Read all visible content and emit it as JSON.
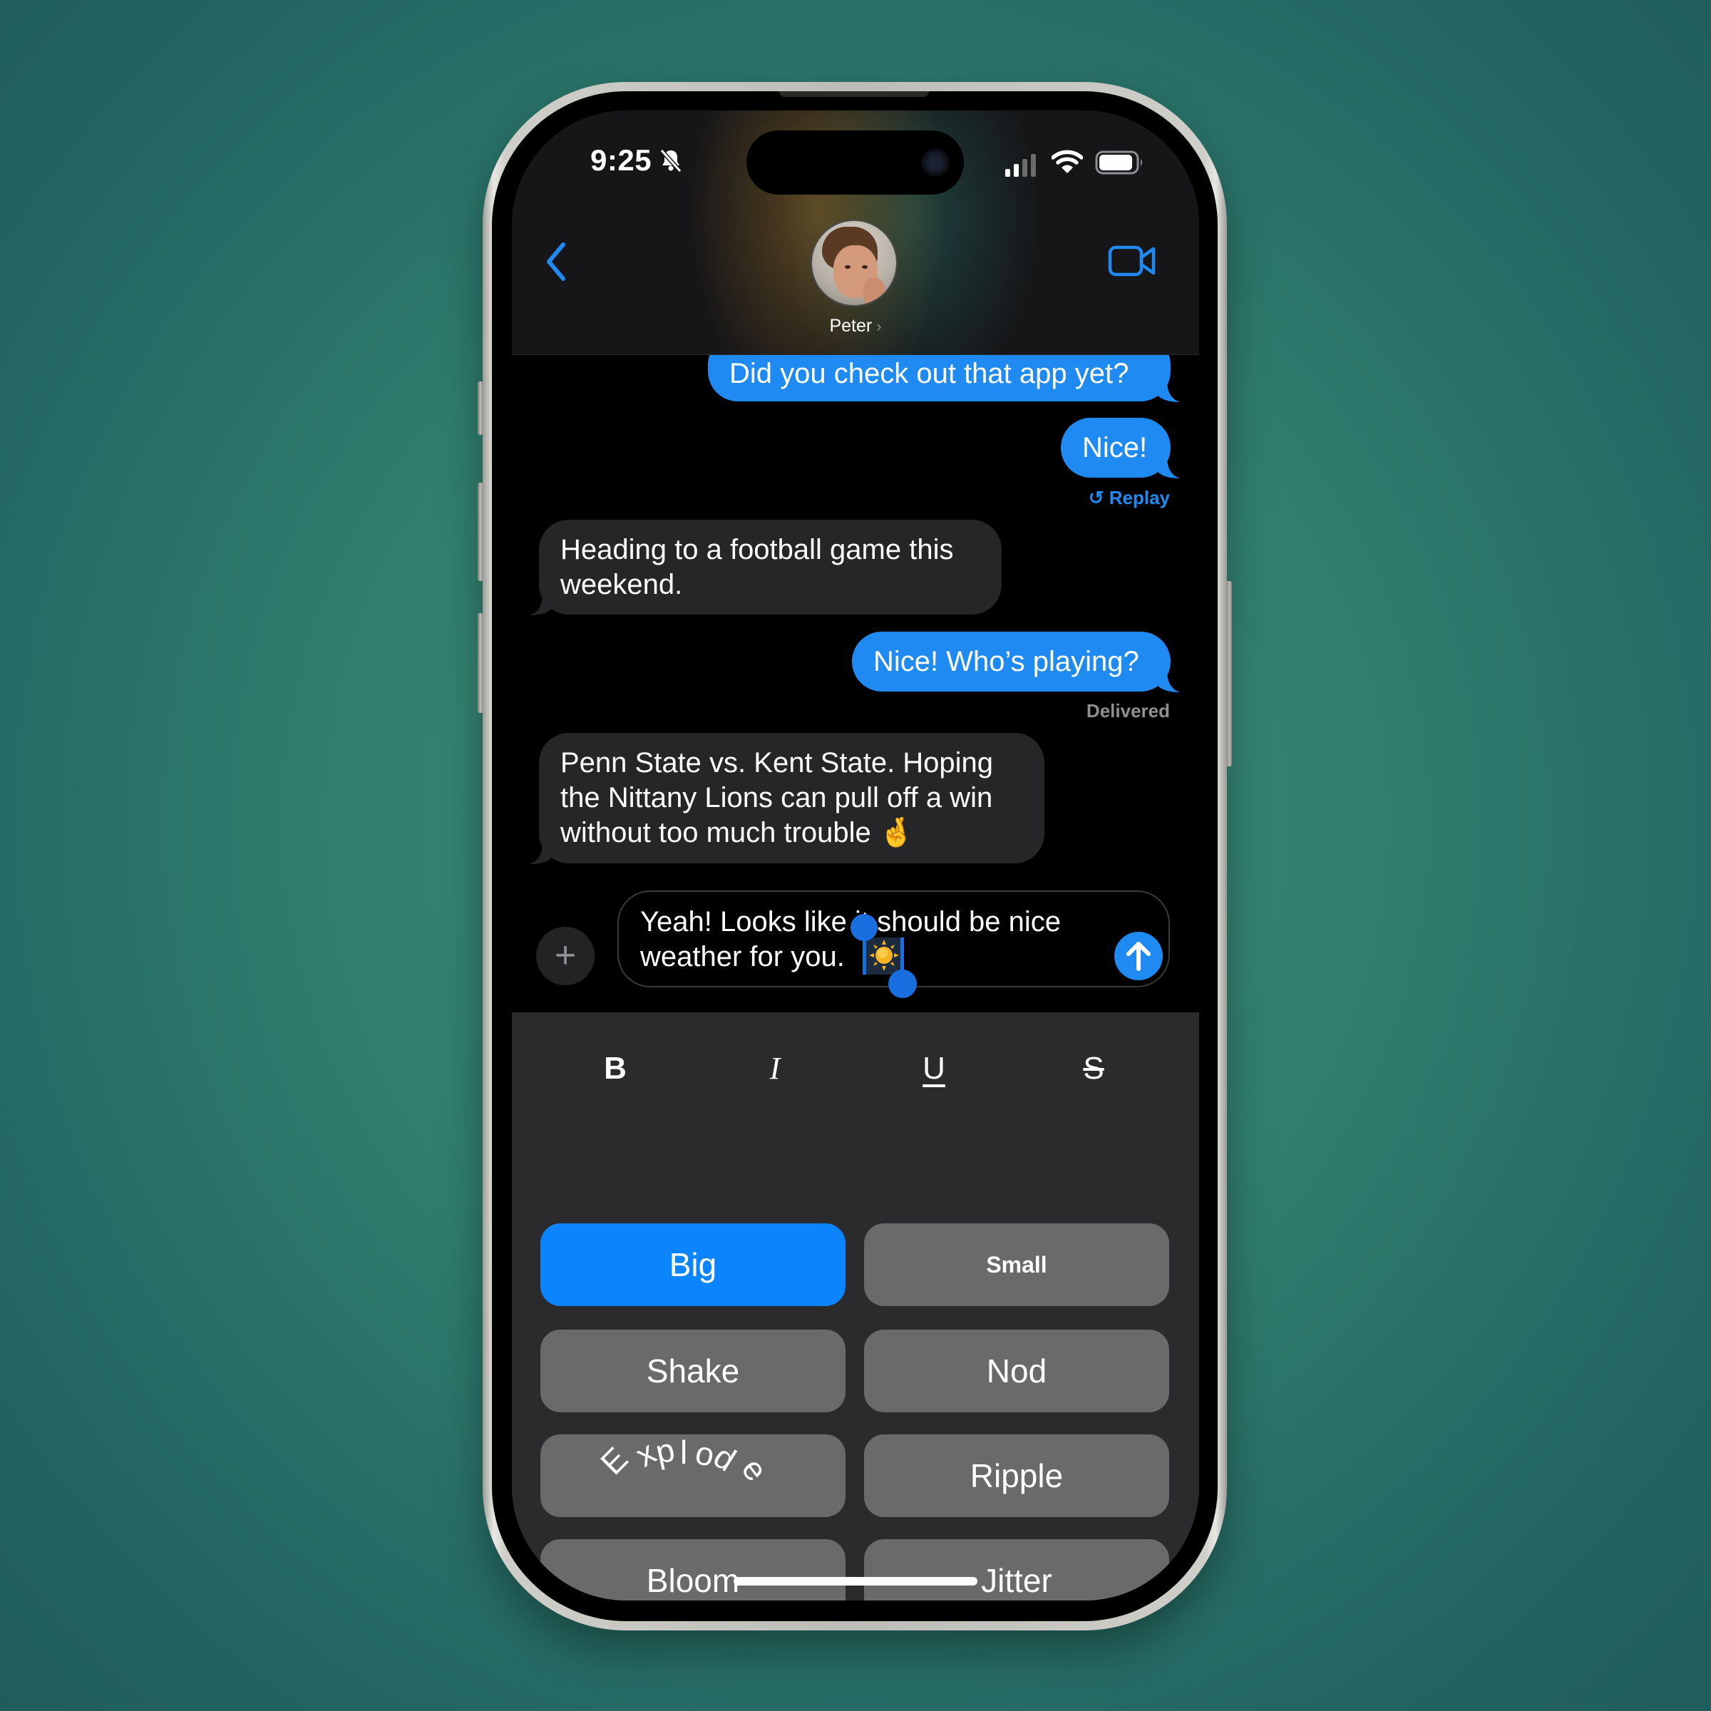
{
  "status_bar": {
    "time": "9:25",
    "silent_mode": true,
    "signal_bars_active": 2,
    "signal_bars_total": 4,
    "wifi": "connected",
    "battery_percent": 90
  },
  "header": {
    "back_icon": "chevron-left-icon",
    "contact_name": "Peter",
    "contact_chevron": "›",
    "video_icon": "video-camera-icon"
  },
  "messages": [
    {
      "direction": "sent",
      "text": "Did you check out that app yet?"
    },
    {
      "direction": "sent",
      "text": "Nice!"
    },
    {
      "direction": "received",
      "text": "Heading to a football game this weekend."
    },
    {
      "direction": "sent",
      "text": "Nice! Who’s playing?"
    },
    {
      "direction": "received",
      "text": "Penn State vs. Kent State. Hoping the Nittany Lions can pull off a win without too much trouble 🤞"
    }
  ],
  "message_meta": {
    "replay_label": "Replay",
    "delivered_label": "Delivered"
  },
  "composer": {
    "plus_label": "+",
    "text_line1": "Yeah! Looks like it should be nice",
    "text_line2": "weather for you.",
    "selected_emoji": "☀️",
    "send_icon": "arrow-up-icon"
  },
  "format_bar": {
    "bold": "B",
    "italic": "I",
    "underline": "U",
    "strikethrough": "S"
  },
  "effects": {
    "selected": "Big",
    "buttons": [
      "Big",
      "Small",
      "Shake",
      "Nod",
      "Explode",
      "Ripple",
      "Bloom",
      "Jitter"
    ]
  },
  "colors": {
    "accent_blue": "#1f8af2",
    "selected_effect": "#0b84fe",
    "received_bubble": "#262628",
    "effect_button": "#6a6a6a",
    "panel_bg": "#2b2b2d"
  }
}
